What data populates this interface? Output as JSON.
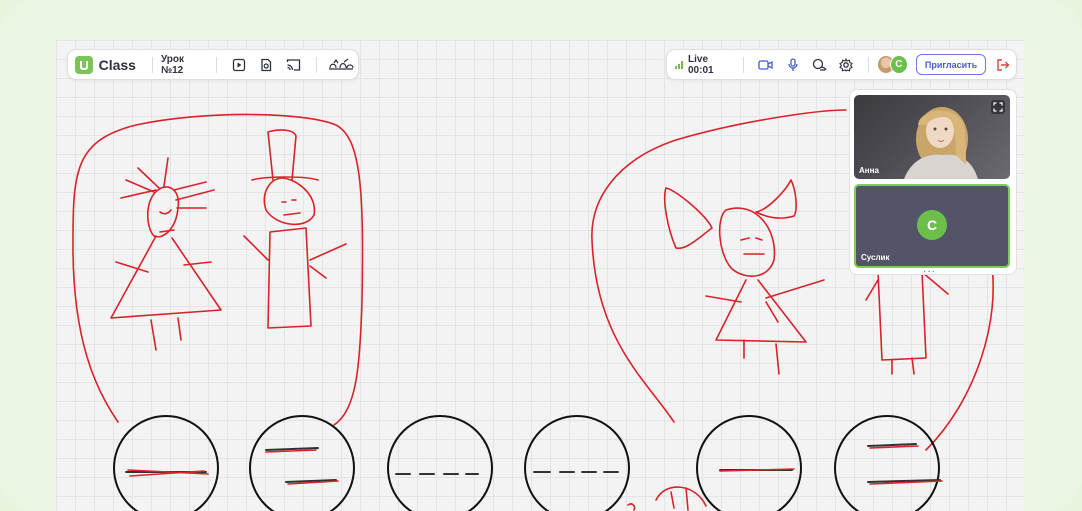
{
  "app": {
    "name": "Class",
    "lesson": "Урок №12"
  },
  "toolbar_left": {
    "icons": [
      "video-file-icon",
      "document-icon",
      "cast-icon",
      "hats-icon"
    ]
  },
  "toolbar_right": {
    "live_label": "Live 00:01",
    "icons": [
      "camera-icon",
      "microphone-icon",
      "chat-icon",
      "settings-icon",
      "exit-icon"
    ],
    "invite_label": "Пригласить",
    "avatar_initial": "C"
  },
  "participants": [
    {
      "name": "Анна",
      "type": "video"
    },
    {
      "name": "Суслик",
      "initial": "C",
      "type": "avatar"
    }
  ],
  "colors": {
    "accent_green": "#7cc35b",
    "ink_red": "#d8232a",
    "invite_blue": "#4a5ad0"
  }
}
